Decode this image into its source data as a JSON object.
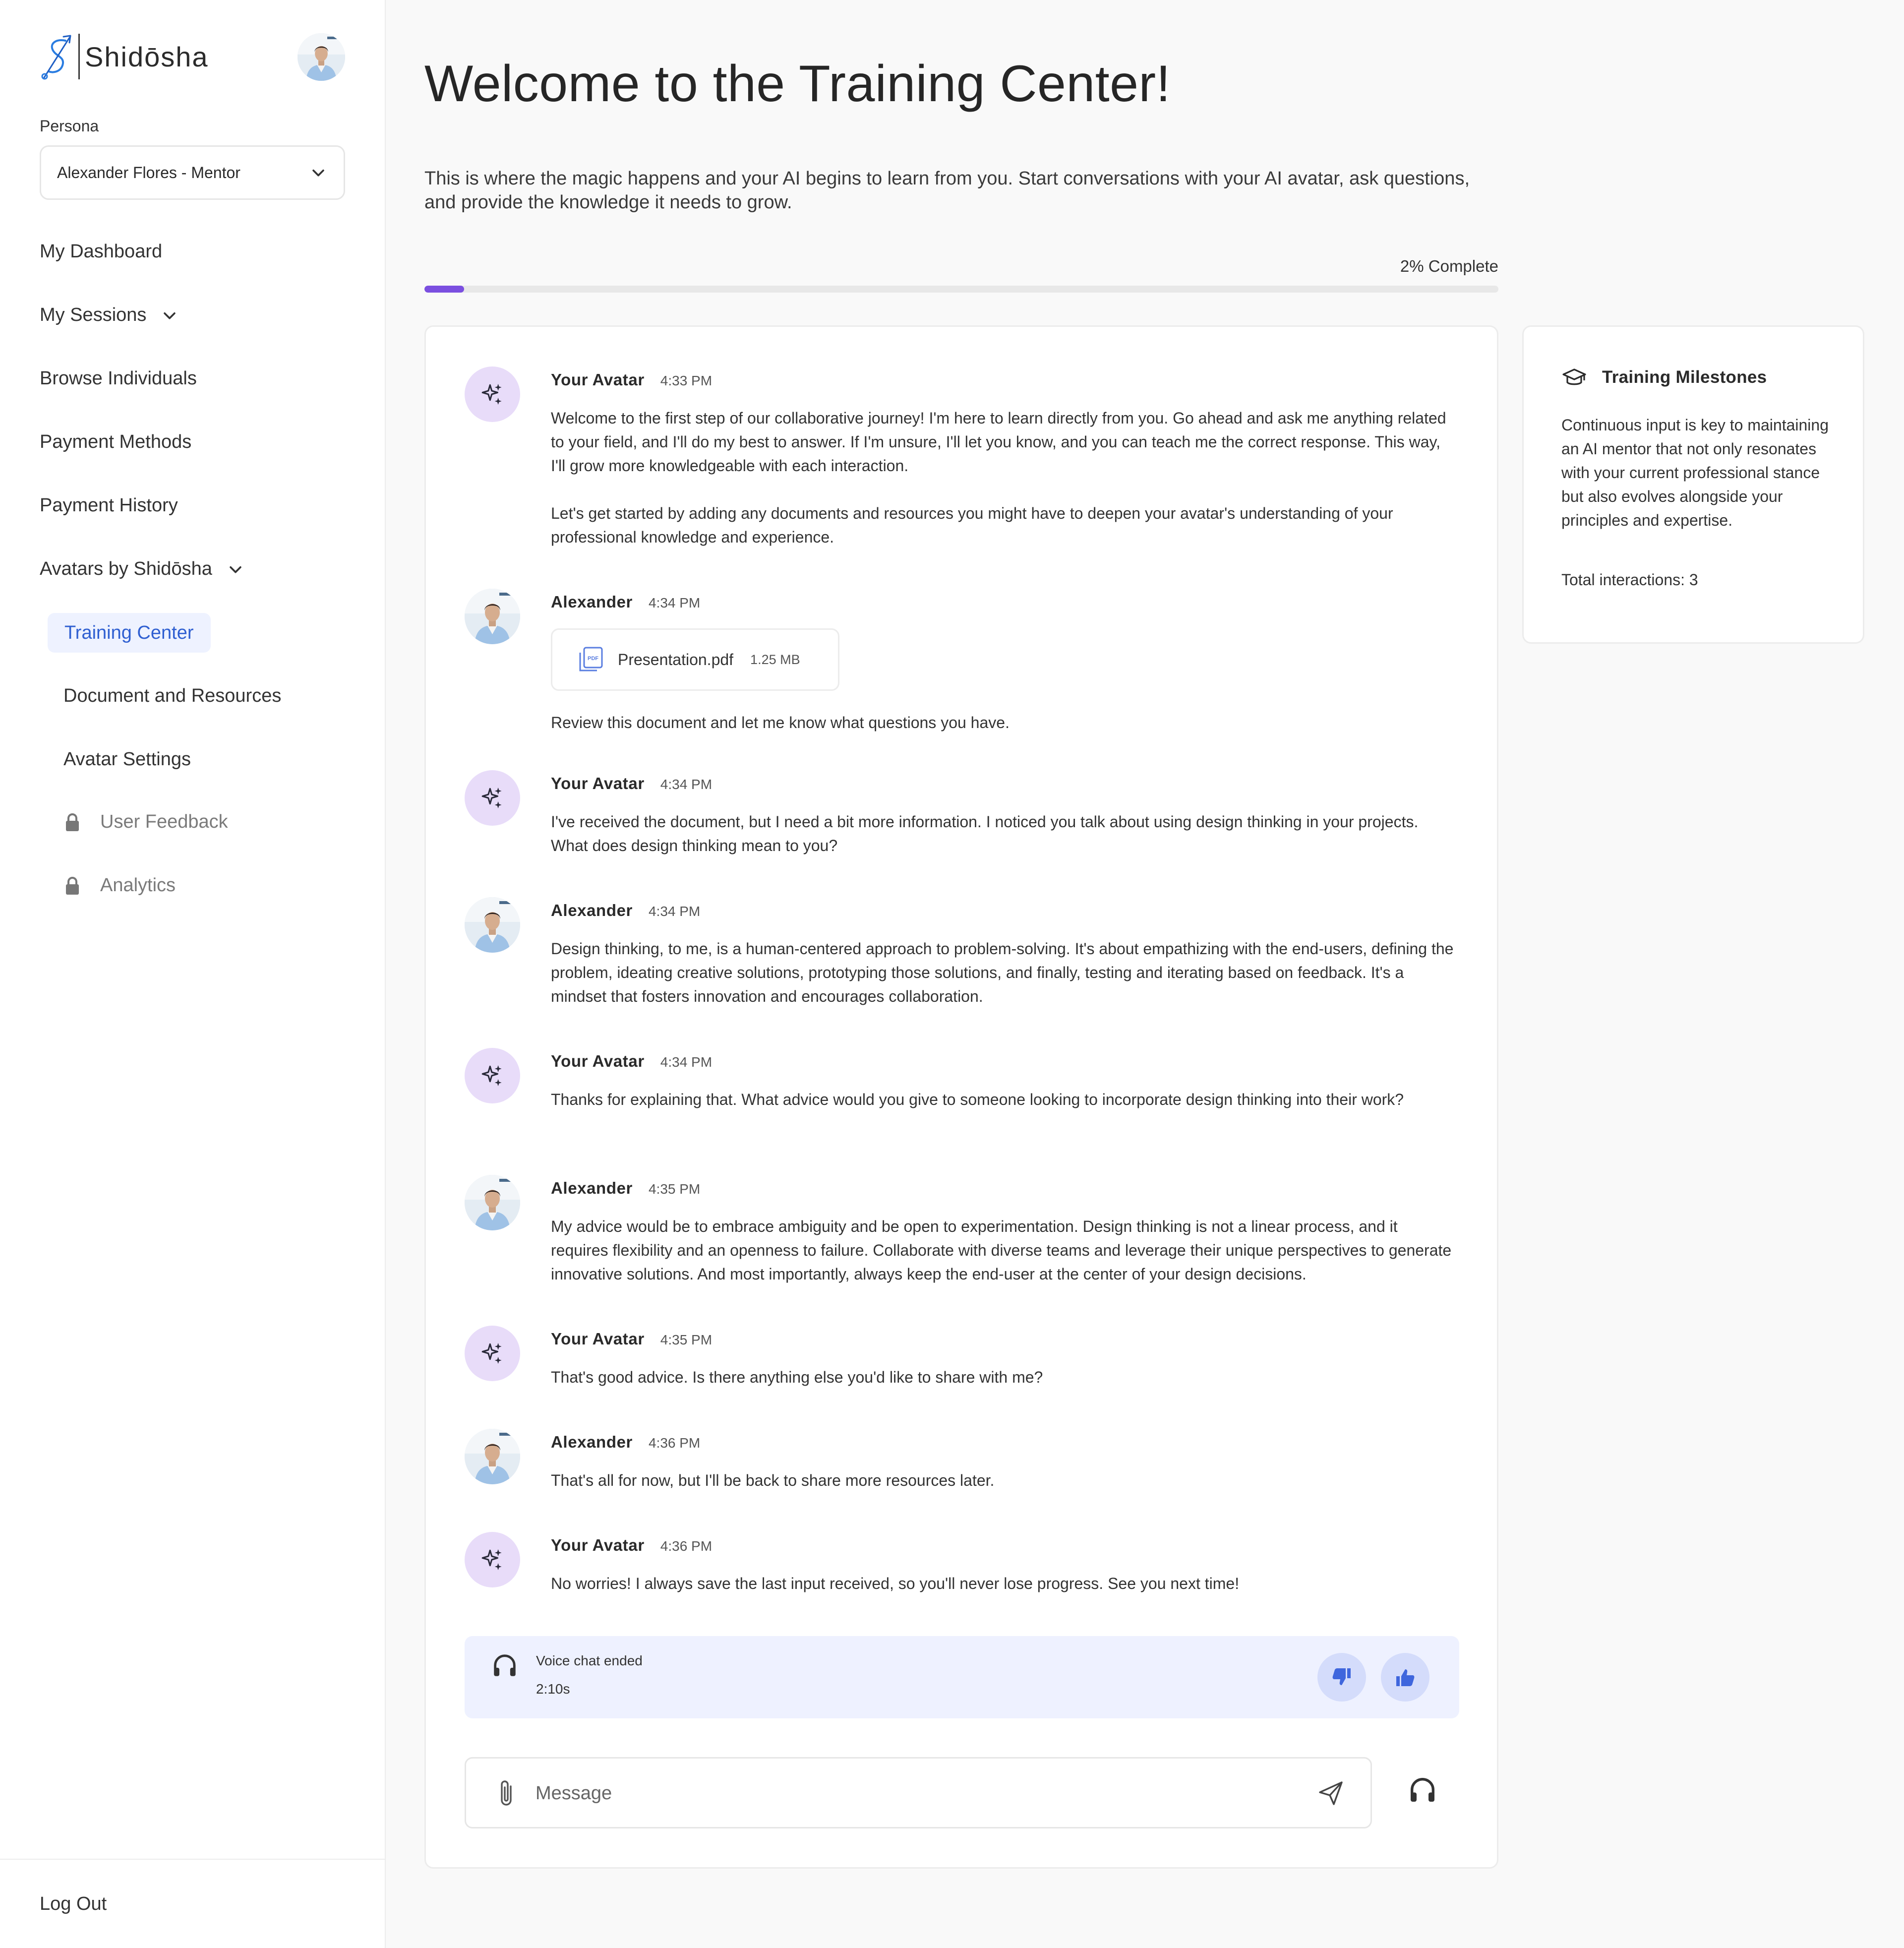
{
  "brand": {
    "name": "Shidōsha"
  },
  "persona": {
    "label": "Persona",
    "selected": "Alexander Flores - Mentor"
  },
  "nav": {
    "dashboard": "My Dashboard",
    "sessions": "My Sessions",
    "browse": "Browse Individuals",
    "payment_methods": "Payment Methods",
    "payment_history": "Payment History",
    "avatars": "Avatars by Shidōsha",
    "training_center": "Training Center",
    "documents": "Document and Resources",
    "avatar_settings": "Avatar Settings",
    "user_feedback": "User Feedback",
    "analytics": "Analytics",
    "logout": "Log Out"
  },
  "page": {
    "title": "Welcome to the Training Center!",
    "description": "This is where the magic happens and your AI begins to learn from you. Start conversations with your AI avatar, ask questions, and provide the knowledge it needs to grow.",
    "progress_text": "2% Complete",
    "progress_percent": 3.7
  },
  "messages": [
    {
      "sender": "Your Avatar",
      "time": "4:33 PM",
      "paragraphs": [
        "Welcome to the first step of our collaborative journey! I'm here to learn directly from you. Go ahead and ask me anything related to your field, and I'll do my best to answer. If I'm unsure, I'll let you know, and you can teach me the correct response. This way, I'll grow more knowledgeable with each interaction.",
        "Let's get started by adding any documents and resources you might have to deepen your avatar's understanding of your professional knowledge and experience."
      ]
    },
    {
      "sender": "Alexander",
      "time": "4:34 PM",
      "attachment": {
        "name": "Presentation.pdf",
        "size": "1.25 MB"
      },
      "text": "Review this document and let me know what questions you have."
    },
    {
      "sender": "Your Avatar",
      "time": "4:34 PM",
      "text": "I've received the document, but I need a bit more information. I noticed you talk about using design thinking in your projects. What does design thinking mean to you?"
    },
    {
      "sender": "Alexander",
      "time": "4:34 PM",
      "text": "Design thinking, to me, is a human-centered approach to problem-solving. It's about empathizing with the end-users, defining the problem, ideating creative solutions, prototyping those solutions, and finally, testing and iterating based on feedback. It's a mindset that fosters innovation and encourages collaboration."
    },
    {
      "sender": "Your Avatar",
      "time": "4:34 PM",
      "text": "Thanks for explaining that. What advice would you give to someone looking to incorporate design thinking into their work?"
    },
    {
      "sender": "Alexander",
      "time": "4:35 PM",
      "text": "My advice would be to embrace ambiguity and be open to experimentation. Design thinking is not a linear process, and it requires flexibility and an openness to failure. Collaborate with diverse teams and leverage their unique perspectives to generate innovative solutions. And most importantly, always keep the end-user at the center of your design decisions."
    },
    {
      "sender": "Your Avatar",
      "time": "4:35 PM",
      "text": "That's good advice. Is there anything else you'd like to share with me?"
    },
    {
      "sender": "Alexander",
      "time": "4:36 PM",
      "text": "That's all for now, but I'll be back to share more resources later."
    },
    {
      "sender": "Your Avatar",
      "time": "4:36 PM",
      "text": "No worries! I always save the last input received, so you'll never lose progress. See you next time!"
    }
  ],
  "voice_chat": {
    "status": "Voice chat ended",
    "duration": "2:10s"
  },
  "composer": {
    "placeholder": "Message"
  },
  "milestones": {
    "title": "Training Milestones",
    "description": "Continuous input is key to maintaining an AI mentor that not only resonates with your current professional stance but also evolves alongside your principles and expertise.",
    "interactions": "Total interactions: 3"
  },
  "icons": {
    "logo": "shidosha-logo-icon",
    "ai_avatar": "sparkles-icon",
    "lock": "lock-icon",
    "pdf": "pdf-file-icon",
    "headphones": "headphones-icon",
    "thumbs_down": "thumbs-down-icon",
    "thumbs_up": "thumbs-up-icon",
    "attach": "paperclip-icon",
    "send": "send-icon",
    "milestone": "graduation-cap-icon"
  },
  "colors": {
    "accent": "#7b4fe0",
    "nav_active_bg": "#eef2ff",
    "nav_active_text": "#2f5fd1",
    "ai_avatar_bg": "#e8dcf9",
    "voice_box_bg": "#eef1ff",
    "feedback_btn": "#d4dcfb"
  }
}
